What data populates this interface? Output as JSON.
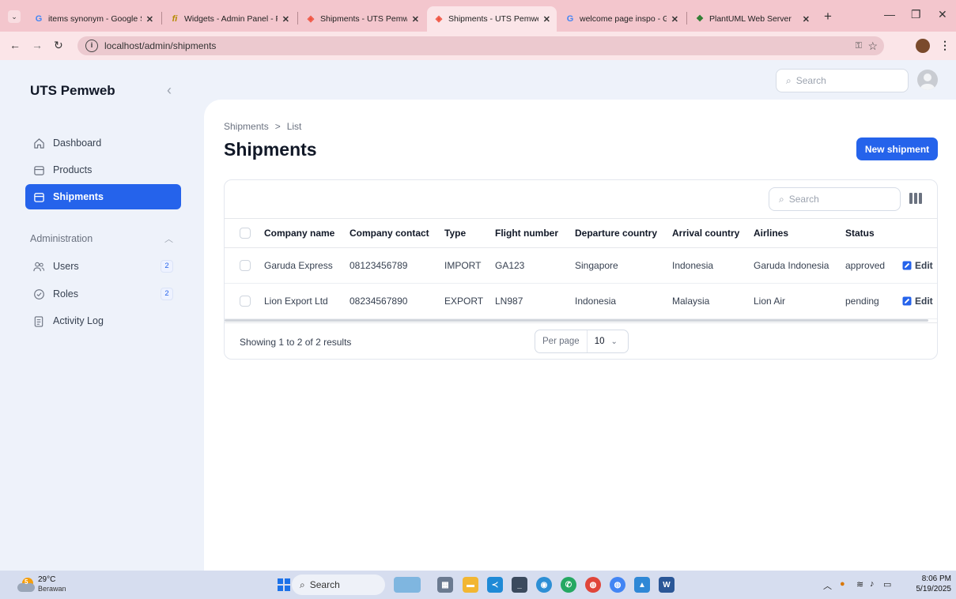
{
  "browser": {
    "tabs": [
      {
        "label": "items synonym - Google S",
        "icon": "google-icon",
        "active": false
      },
      {
        "label": "Widgets - Admin Panel - F",
        "icon": "filament-icon",
        "active": false
      },
      {
        "label": "Shipments - UTS Pemweb",
        "icon": "laravel-icon",
        "active": false
      },
      {
        "label": "Shipments - UTS Pemweb",
        "icon": "laravel-icon",
        "active": true
      },
      {
        "label": "welcome page inspo - Goo",
        "icon": "google-icon",
        "active": false
      },
      {
        "label": "PlantUML Web Server",
        "icon": "plantuml-icon",
        "active": false
      }
    ],
    "url": "localhost/admin/shipments",
    "colors": {
      "tabstrip": "#f3c6cd",
      "toolbar": "#fbe5e8"
    }
  },
  "app": {
    "brand": "UTS Pemweb",
    "search_placeholder": "Search",
    "sidebar": {
      "items": [
        {
          "label": "Dashboard",
          "icon": "home-icon",
          "active": false
        },
        {
          "label": "Products",
          "icon": "box-icon",
          "active": false
        },
        {
          "label": "Shipments",
          "icon": "box-icon",
          "active": true
        }
      ],
      "group": {
        "title": "Administration",
        "items": [
          {
            "label": "Users",
            "icon": "users-icon",
            "badge": "2"
          },
          {
            "label": "Roles",
            "icon": "shield-check-icon",
            "badge": "2"
          },
          {
            "label": "Activity Log",
            "icon": "clipboard-icon",
            "badge": ""
          }
        ]
      }
    },
    "breadcrumb": {
      "parent": "Shipments",
      "separator": ">",
      "current": "List"
    },
    "page_title": "Shipments",
    "new_button": "New shipment",
    "table": {
      "search_placeholder": "Search",
      "columns": [
        "Company name",
        "Company contact",
        "Type",
        "Flight number",
        "Departure country",
        "Arrival country",
        "Airlines",
        "Status"
      ],
      "rows": [
        {
          "company": "Garuda Express",
          "contact": "08123456789",
          "type": "IMPORT",
          "flight": "GA123",
          "departure": "Singapore",
          "arrival": "Indonesia",
          "airline": "Garuda Indonesia",
          "status": "approved",
          "action": "Edit"
        },
        {
          "company": "Lion Export Ltd",
          "contact": "08234567890",
          "type": "EXPORT",
          "flight": "LN987",
          "departure": "Indonesia",
          "arrival": "Malaysia",
          "airline": "Lion Air",
          "status": "pending",
          "action": "Edit"
        }
      ],
      "showing": "Showing 1 to 2 of 2 results",
      "per_page_label": "Per page",
      "per_page_value": "10"
    },
    "colors": {
      "primary": "#2563eb",
      "background": "#eef2fa"
    }
  },
  "taskbar": {
    "weather": {
      "temp": "29°C",
      "condition": "Berawan",
      "badge": "5"
    },
    "search_placeholder": "Search",
    "time": "8:06 PM",
    "date": "5/19/2025"
  }
}
